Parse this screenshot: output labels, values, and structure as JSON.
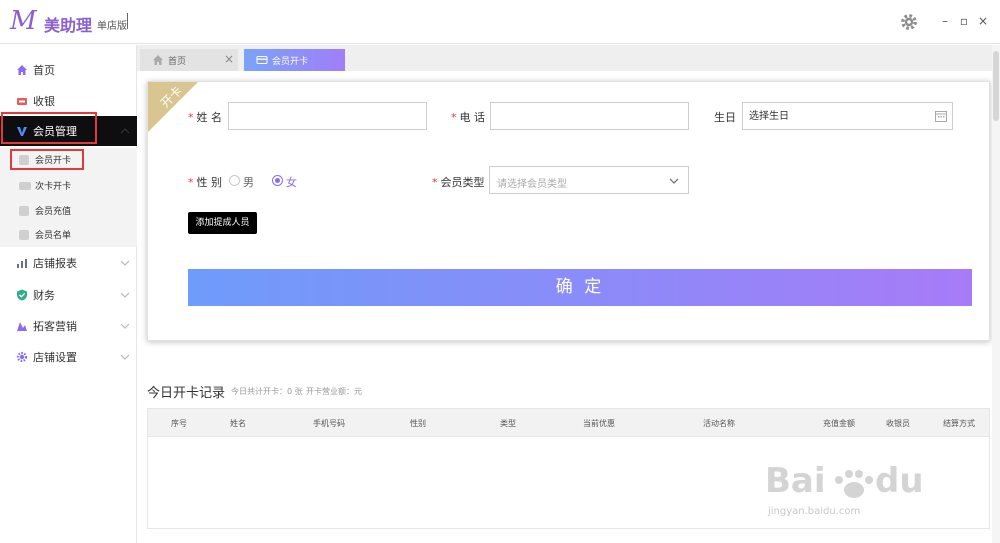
{
  "app": {
    "logo_letter": "M",
    "name": "美助理",
    "edition": "单店版"
  },
  "window": {
    "minimize": "–",
    "maximize": "▫",
    "close": "×"
  },
  "sidebar": {
    "items": [
      {
        "label": "首页",
        "icon": "home-icon"
      },
      {
        "label": "收银",
        "icon": "cashier-icon"
      },
      {
        "label": "会员管理",
        "icon": "member-v-icon"
      },
      {
        "label": "店铺报表",
        "icon": "bar-chart-icon"
      },
      {
        "label": "财务",
        "icon": "shield-icon"
      },
      {
        "label": "拓客营销",
        "icon": "marketing-icon"
      },
      {
        "label": "店铺设置",
        "icon": "gear-icon"
      }
    ],
    "sub_items": [
      {
        "label": "会员开卡"
      },
      {
        "label": "次卡开卡"
      },
      {
        "label": "会员充值"
      },
      {
        "label": "会员名单"
      }
    ]
  },
  "tabs": [
    {
      "label": "首页",
      "icon": "home-icon",
      "close": "×"
    },
    {
      "label": "会员开卡",
      "icon": "card-icon"
    }
  ],
  "form": {
    "ribbon": "开卡",
    "name_label": "姓 名",
    "phone_label": "电 话",
    "birthday_label": "生日",
    "birthday_placeholder": "选择生日",
    "gender_label": "性 别",
    "gender_options": [
      "男",
      "女"
    ],
    "gender_selected": "女",
    "member_type_label": "会员类型",
    "member_type_placeholder": "请选择会员类型",
    "add_staff_button": "添加提成人员",
    "confirm_button": "确 定",
    "required_mark": "*"
  },
  "records": {
    "title": "今日开卡记录",
    "count_text": "今日共计开卡：0 张",
    "amount_text": "开卡营业额：元",
    "columns": [
      "序号",
      "姓名",
      "手机号码",
      "性别",
      "类型",
      "当前优惠",
      "活动名称",
      "充值金额",
      "收银员",
      "结算方式"
    ]
  },
  "watermark": {
    "text": "jingyan.baidu.com"
  },
  "colors": {
    "brand": "#8a5fd0",
    "accent_start": "#6e9cfb",
    "accent_end": "#a77bf7",
    "required": "#e03a3a",
    "sidebar_active": "#0e0e10",
    "ribbon": "#d9c58f"
  }
}
